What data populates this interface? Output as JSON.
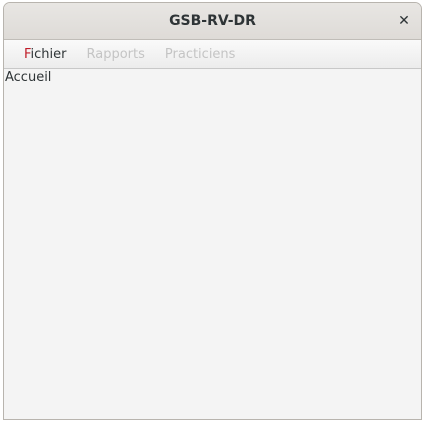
{
  "window": {
    "title": "GSB-RV-DR",
    "close_icon": "close-icon"
  },
  "menubar": {
    "items": [
      {
        "mnemonic": "F",
        "rest": "ichier",
        "enabled": true
      },
      {
        "label": "Rapports",
        "enabled": false
      },
      {
        "label": "Practiciens",
        "enabled": false
      }
    ]
  },
  "content": {
    "heading": "Accueil"
  }
}
